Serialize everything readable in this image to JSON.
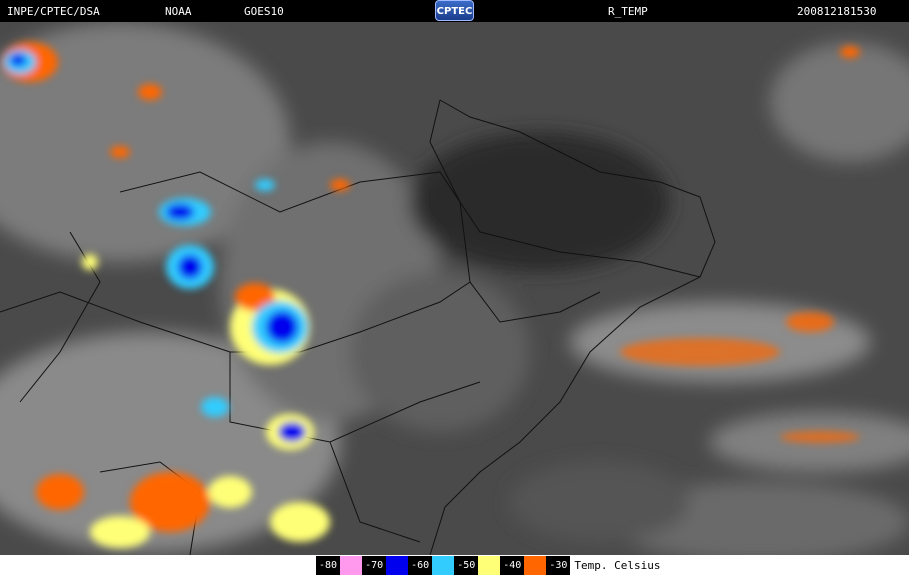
{
  "header": {
    "institution": "INPE/CPTEC/DSA",
    "agency": "NOAA",
    "satellite": "GOES10",
    "logo_text": "CPTEC",
    "product": "R_TEMP",
    "datetime": "200812181530"
  },
  "legend": {
    "items": [
      {
        "label": "-80",
        "color": "#ff99ee"
      },
      {
        "label": "-70",
        "color": "#0000ee"
      },
      {
        "label": "-60",
        "color": "#33ccff"
      },
      {
        "label": "-50",
        "color": "#ffff77"
      },
      {
        "label": "-40",
        "color": "#ff6600"
      },
      {
        "label": "-30",
        "color": ""
      }
    ],
    "unit": "Temp. Celsius"
  }
}
